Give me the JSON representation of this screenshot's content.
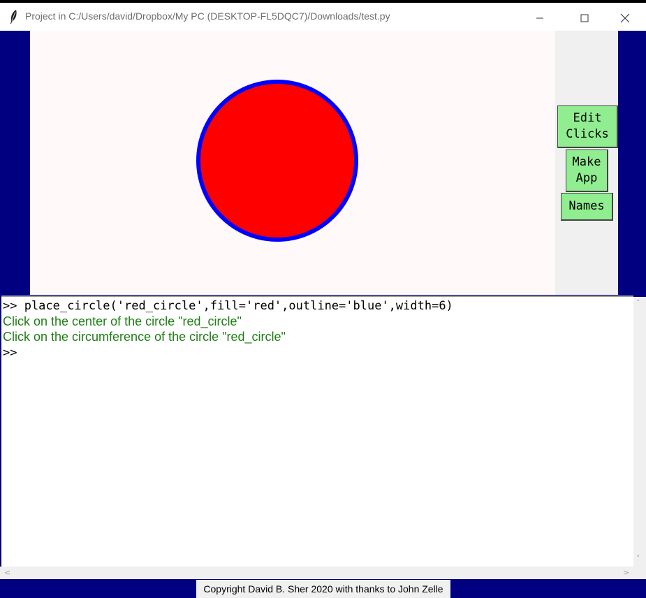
{
  "window": {
    "title": "Project in C:/Users/david/Dropbox/My PC (DESKTOP-FL5DQC7)/Downloads/test.py",
    "icon": "feather-icon",
    "controls": [
      "minimize-icon",
      "maximize-icon",
      "close-icon"
    ]
  },
  "colors": {
    "frame": "#000080",
    "canvas_bg": "#fff9f9",
    "button_bg": "#90ee90",
    "circle_fill": "#ff0000",
    "circle_outline": "#0000ff",
    "message_text": "#1e7d14"
  },
  "side_buttons": {
    "edit_clicks": "Edit\nClicks",
    "make_app": "Make\nApp",
    "names": "Names"
  },
  "console": {
    "lines": [
      ">> place_circle('red_circle',fill='red',outline='blue',width=6)",
      "Click on the center of the circle \"red_circle\"",
      "Click on the circumference of the circle \"red_circle\"",
      ">>"
    ]
  },
  "footer": {
    "text": "Copyright David B. Sher 2020 with thanks to John Zelle"
  }
}
